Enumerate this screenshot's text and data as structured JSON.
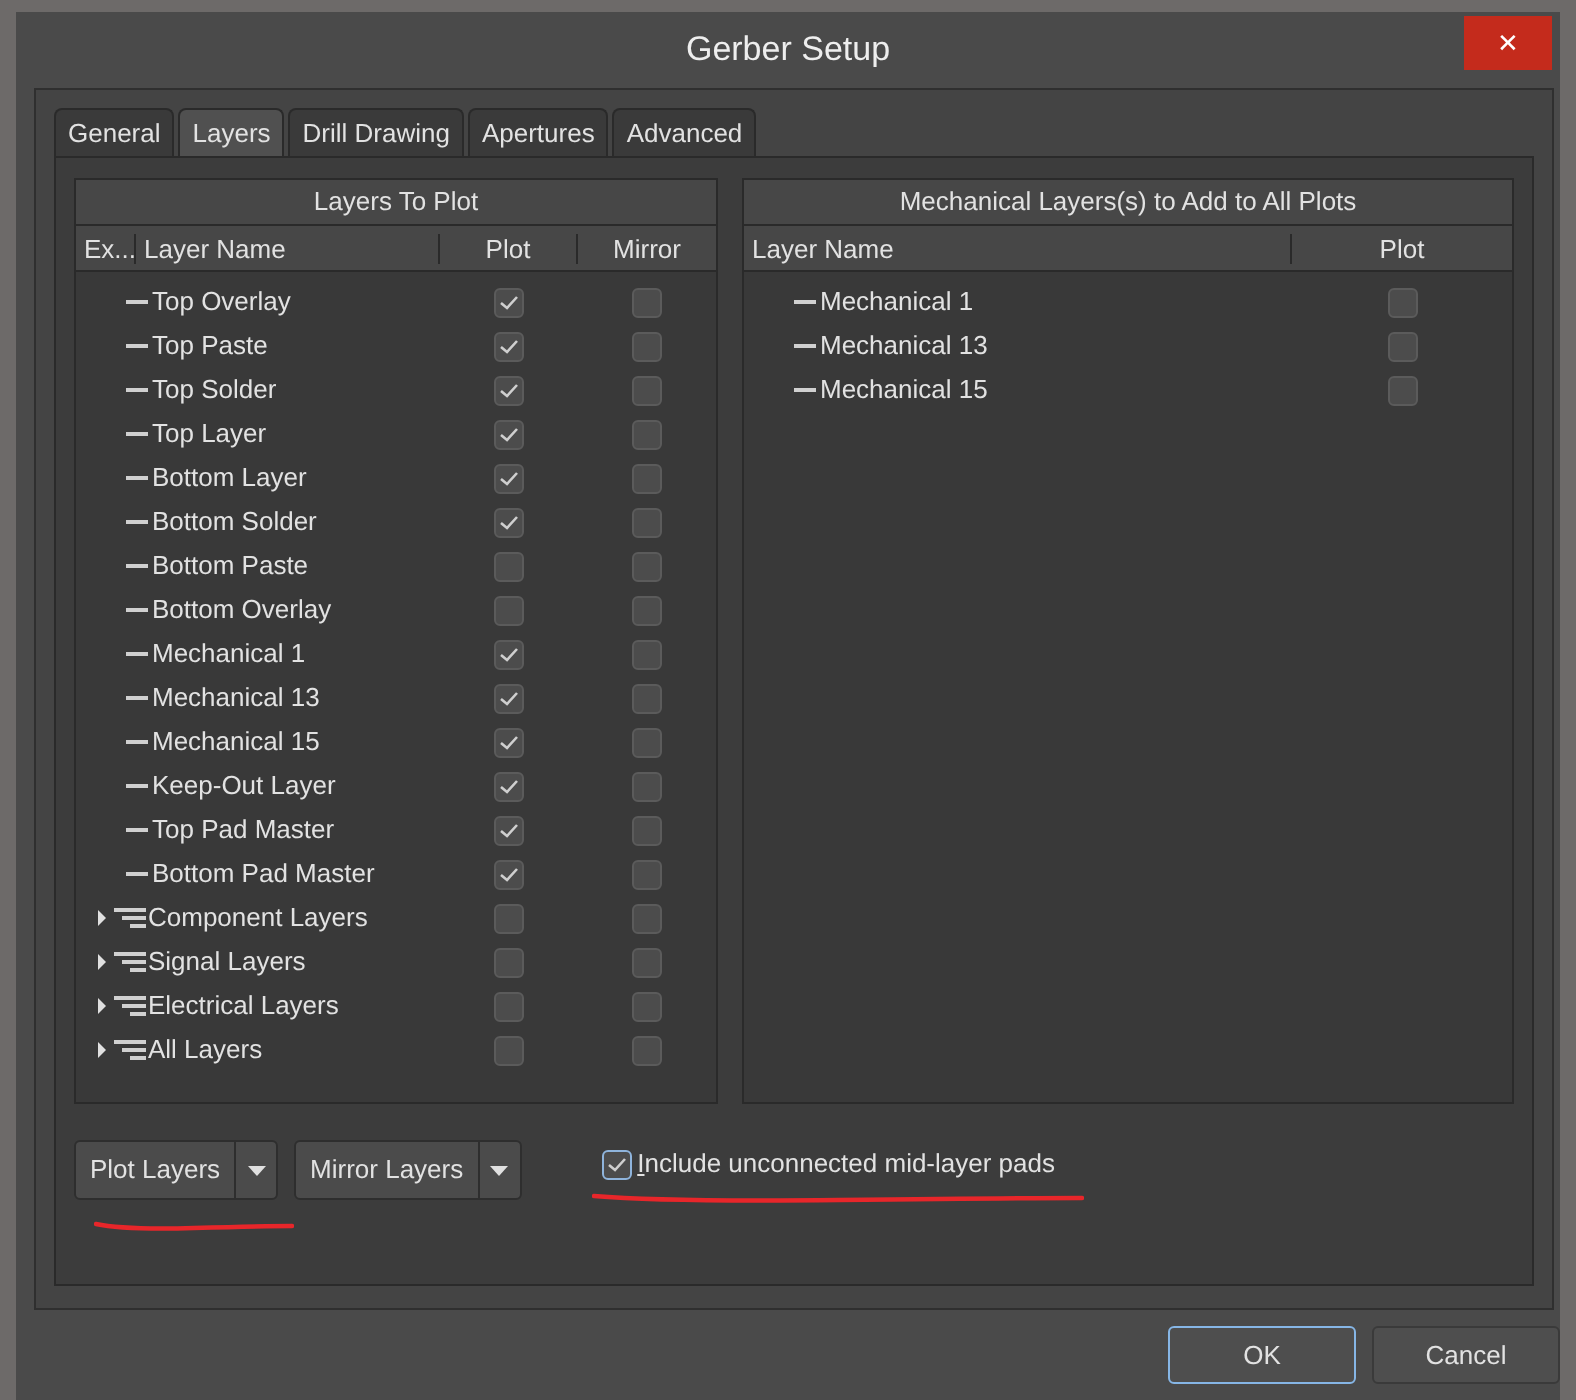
{
  "window": {
    "title": "Gerber Setup",
    "close": "✕"
  },
  "tabs": [
    {
      "label": "General",
      "selected": false
    },
    {
      "label": "Layers",
      "selected": true
    },
    {
      "label": "Drill Drawing",
      "selected": false
    },
    {
      "label": "Apertures",
      "selected": false
    },
    {
      "label": "Advanced",
      "selected": false
    }
  ],
  "layers_to_plot": {
    "title": "Layers To Plot",
    "columns": [
      "Ex...",
      "Layer Name",
      "Plot",
      "Mirror"
    ],
    "rows": [
      {
        "kind": "layer",
        "name": "Top Overlay",
        "plot": true,
        "mirror": false
      },
      {
        "kind": "layer",
        "name": "Top Paste",
        "plot": true,
        "mirror": false
      },
      {
        "kind": "layer",
        "name": "Top Solder",
        "plot": true,
        "mirror": false
      },
      {
        "kind": "layer",
        "name": "Top Layer",
        "plot": true,
        "mirror": false
      },
      {
        "kind": "layer",
        "name": "Bottom Layer",
        "plot": true,
        "mirror": false
      },
      {
        "kind": "layer",
        "name": "Bottom Solder",
        "plot": true,
        "mirror": false
      },
      {
        "kind": "layer",
        "name": "Bottom Paste",
        "plot": false,
        "mirror": false
      },
      {
        "kind": "layer",
        "name": "Bottom Overlay",
        "plot": false,
        "mirror": false
      },
      {
        "kind": "layer",
        "name": "Mechanical 1",
        "plot": true,
        "mirror": false
      },
      {
        "kind": "layer",
        "name": "Mechanical 13",
        "plot": true,
        "mirror": false
      },
      {
        "kind": "layer",
        "name": "Mechanical 15",
        "plot": true,
        "mirror": false
      },
      {
        "kind": "layer",
        "name": "Keep-Out Layer",
        "plot": true,
        "mirror": false
      },
      {
        "kind": "layer",
        "name": "Top Pad Master",
        "plot": true,
        "mirror": false
      },
      {
        "kind": "layer",
        "name": "Bottom Pad Master",
        "plot": true,
        "mirror": false
      },
      {
        "kind": "group",
        "name": "Component Layers",
        "plot": false,
        "mirror": false,
        "expanded": false
      },
      {
        "kind": "group",
        "name": "Signal Layers",
        "plot": false,
        "mirror": false,
        "expanded": false
      },
      {
        "kind": "group",
        "name": "Electrical Layers",
        "plot": false,
        "mirror": false,
        "expanded": false
      },
      {
        "kind": "group",
        "name": "All Layers",
        "plot": false,
        "mirror": false,
        "expanded": false
      }
    ]
  },
  "mechanical_layers": {
    "title": "Mechanical Layers(s) to Add to All Plots",
    "columns": [
      "Layer Name",
      "Plot"
    ],
    "rows": [
      {
        "name": "Mechanical 1",
        "plot": false
      },
      {
        "name": "Mechanical 13",
        "plot": false
      },
      {
        "name": "Mechanical 15",
        "plot": false
      }
    ]
  },
  "split_buttons": [
    {
      "label": "Plot Layers",
      "highlighted": true
    },
    {
      "label": "Mirror Layers",
      "highlighted": false
    }
  ],
  "include_mid_layer_pads": {
    "label": "Include unconnected mid-layer pads",
    "checked": true,
    "highlighted": true
  },
  "buttons": [
    {
      "label": "OK",
      "default": true
    },
    {
      "label": "Cancel",
      "default": false
    }
  ]
}
